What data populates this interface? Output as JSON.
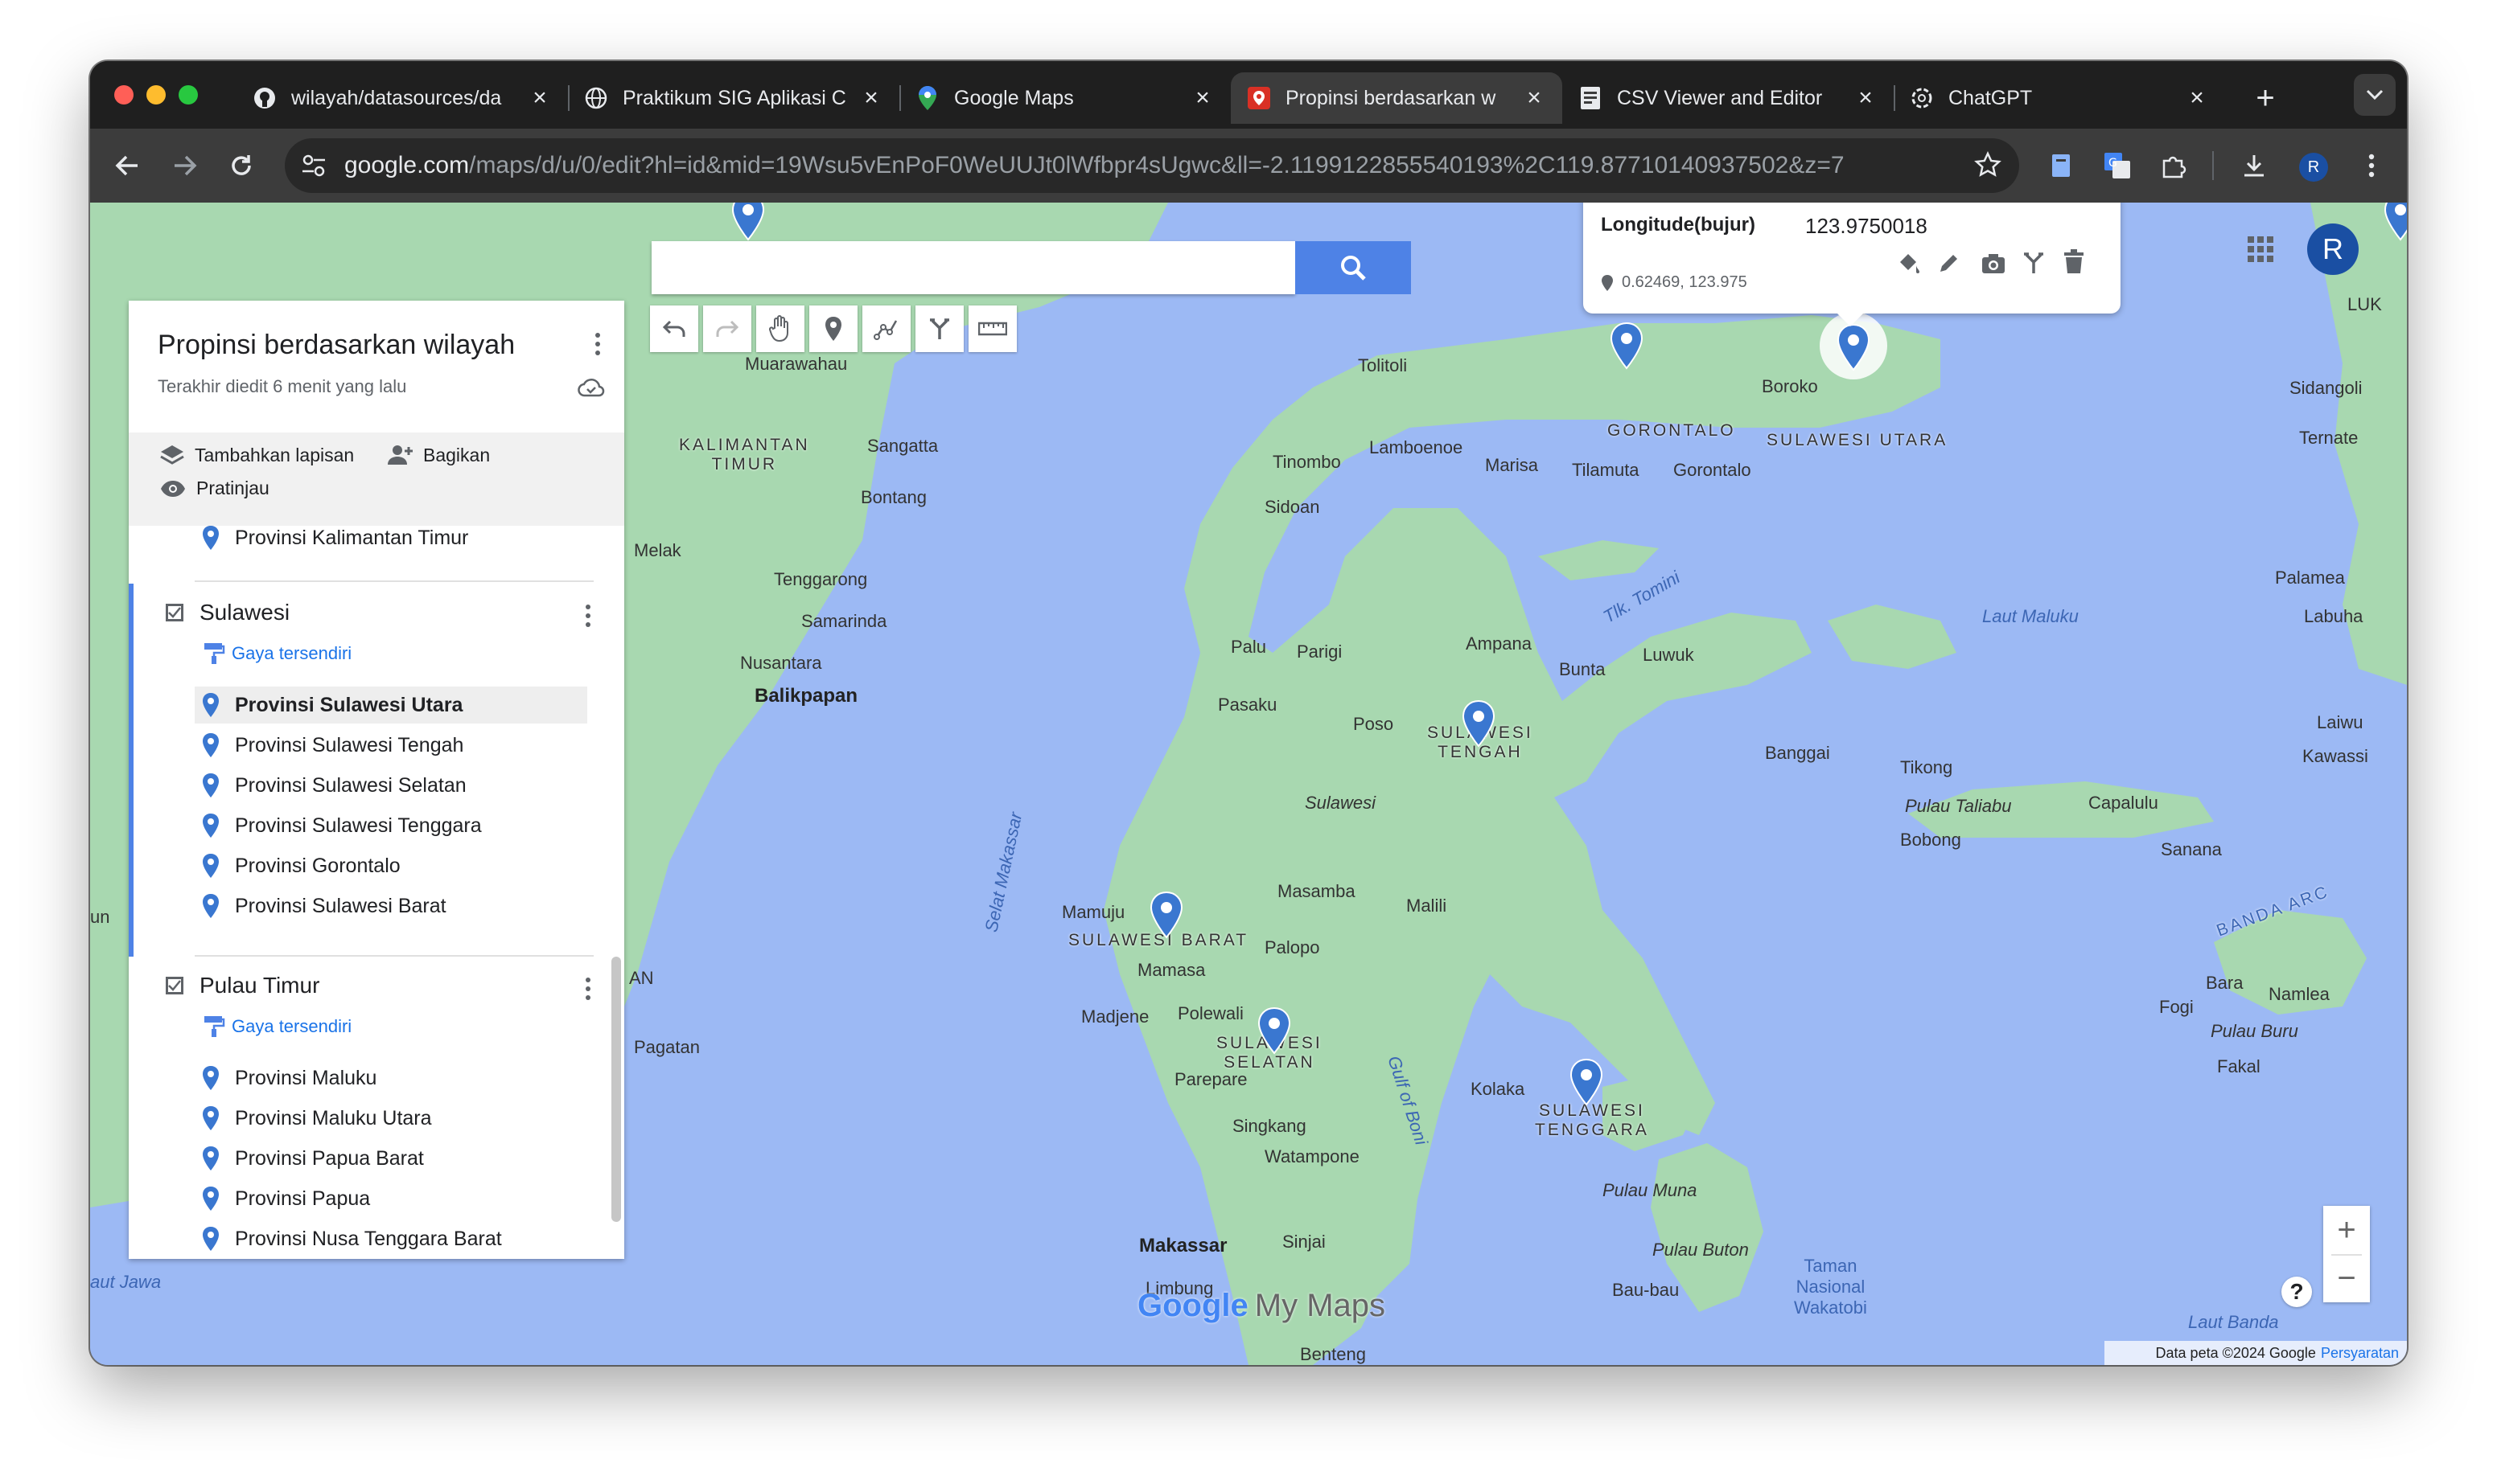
{
  "tabs": [
    {
      "title": "wilayah/datasources/da",
      "icon": "github-icon"
    },
    {
      "title": "Praktikum SIG Aplikasi C",
      "icon": "globe-icon"
    },
    {
      "title": "Google Maps",
      "icon": "maps-pin-icon"
    },
    {
      "title": "Propinsi berdasarkan w",
      "icon": "mymaps-icon",
      "active": true
    },
    {
      "title": "CSV Viewer and Editor",
      "icon": "document-icon"
    },
    {
      "title": "ChatGPT",
      "icon": "openai-icon"
    }
  ],
  "address_bar": {
    "domain": "google.com",
    "path": "/maps/d/u/0/edit?hl=id&mid=19Wsu5vEnPoF0WeUUJt0lWfbpr4sUgwc&ll=-2.1199122855540193%2C119.87710140937502&z=7"
  },
  "browser_profile_initial": "R",
  "panel": {
    "title": "Propinsi berdasarkan wilayah",
    "subtitle": "Terakhir diedit 6 menit yang lalu",
    "actions": {
      "add_layer": "Tambahkan lapisan",
      "share": "Bagikan",
      "preview": "Pratinjau"
    },
    "top_item": "Provinsi Kalimantan Timur",
    "layers": [
      {
        "name": "Sulawesi",
        "style": "Gaya tersendiri",
        "items": [
          "Provinsi Sulawesi Utara",
          "Provinsi Sulawesi Tengah",
          "Provinsi Sulawesi Selatan",
          "Provinsi Sulawesi Tenggara",
          "Provinsi Gorontalo",
          "Provinsi Sulawesi Barat"
        ]
      },
      {
        "name": "Pulau Timur",
        "style": "Gaya tersendiri",
        "items": [
          "Provinsi Maluku",
          "Provinsi Maluku Utara",
          "Provinsi Papua Barat",
          "Provinsi Papua",
          "Provinsi Nusa Tenggara Barat"
        ]
      }
    ]
  },
  "search": {
    "placeholder": ""
  },
  "info_window": {
    "label": "Longitude(bujur)",
    "value": "123.9750018",
    "coords": "0.62469, 123.975"
  },
  "map_labels": {
    "kalimantan_timur": "KALIMANTAN\nTIMUR",
    "sangatta": "Sangatta",
    "bontang": "Bontang",
    "melak": "Melak",
    "tenggarong": "Tenggarong",
    "samarinda": "Samarinda",
    "nusantara": "Nusantara",
    "balikpapan": "Balikpapan",
    "selat_makassar": "Selat Makassar",
    "pagatan": "Pagatan",
    "tolitoli": "Tolitoli",
    "tinombo": "Tinombo",
    "lamboenoe": "Lamboenoe",
    "marisa": "Marisa",
    "gorontalo_region": "GORONTALO",
    "tilamuta": "Tilamuta",
    "gorontalo_city": "Gorontalo",
    "boroko": "Boroko",
    "sulawesi_utara": "SULAWESI UTARA",
    "sidoan": "Sidoan",
    "palu": "Palu",
    "parigi": "Parigi",
    "pasaku": "Pasaku",
    "ampana": "Ampana",
    "bunta": "Bunta",
    "luwuk": "Luwuk",
    "tk_tomini": "Tlk. Tomini",
    "poso": "Poso",
    "sulawesi_tengah": "SULAWESI\nTENGAH",
    "banggai": "Banggai",
    "sulawesi": "Sulawesi",
    "masamba": "Masamba",
    "malili": "Malili",
    "mamuju": "Mamuju",
    "sulawesi_barat": "SULAWESI BARAT",
    "mamasa": "Mamasa",
    "palopo": "Palopo",
    "madjene": "Madjene",
    "polewali": "Polewali",
    "sulawesi_selatan": "SULAWESI\nSELATAN",
    "parepare": "Parepare",
    "gulf_of_boni": "Gulf of Boni",
    "singkang": "Singkang",
    "watampone": "Watampone",
    "kolaka": "Kolaka",
    "sulawesi_tenggara": "SULAWESI\nTENGGARA",
    "makassar": "Makassar",
    "sinjai": "Sinjai",
    "limbung": "Limbung",
    "benteng": "Benteng",
    "pulau_muna": "Pulau Muna",
    "pulau_buton": "Pulau Buton",
    "bau_bau": "Bau-bau",
    "taman_nasional": "Taman\nNasional\nWakatobi",
    "laut_maluku": "Laut Maluku",
    "sidangoli": "Sidangoli",
    "ternate": "Ternate",
    "palamea": "Palamea",
    "labuha": "Labuha",
    "laiwu": "Laiwu",
    "kawassi": "Kawassi",
    "tikong": "Tikong",
    "pulau_taliabu": "Pulau Taliabu",
    "capalulu": "Capalulu",
    "bobong": "Bobong",
    "sanana": "Sanana",
    "banda_arc": "BANDA ARC",
    "bara": "Bara",
    "namlea": "Namlea",
    "fogi": "Fogi",
    "pulau_buru": "Pulau Buru",
    "fakal": "Fakal",
    "laut_banda": "Laut Banda",
    "laut_jawa": "aut Jawa",
    "an": "AN",
    "un": "un",
    "muarawahau": "Muarawahau",
    "maluk": "LUK"
  },
  "branding": {
    "google": "Google",
    "mymaps": "My Maps"
  },
  "footer": {
    "data": "Data peta ©2024 Google",
    "terms": "Persyaratan"
  },
  "user_initial": "R",
  "zoom": {
    "in": "+",
    "out": "−"
  },
  "help": "?",
  "colors": {
    "pin": "#3a77d0",
    "water": "#9cb9f4",
    "land": "#a9d9b0",
    "accent": "#4e82e6"
  }
}
